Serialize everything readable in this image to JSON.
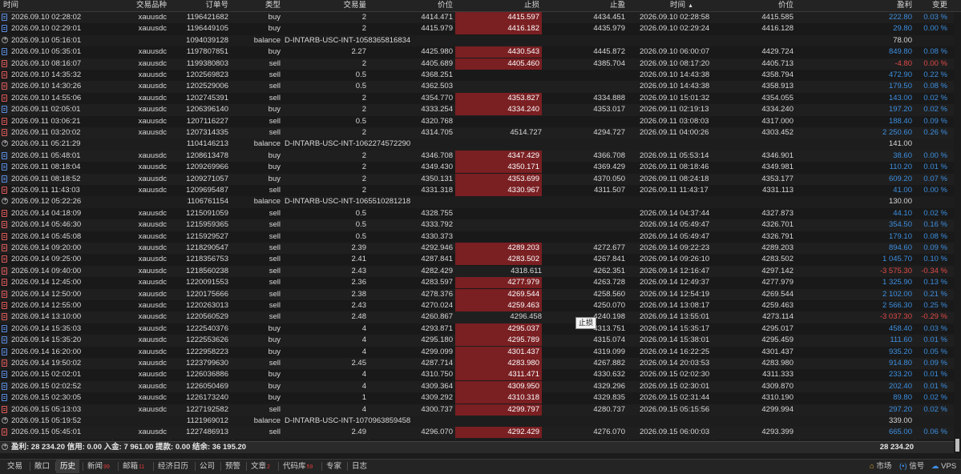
{
  "headers": {
    "time": "时间",
    "symbol": "交易品种",
    "order": "订单号",
    "type": "类型",
    "volume": "交易量",
    "price": "价位",
    "sl": "止损",
    "tp": "止盈",
    "close_time": "时间",
    "close_price": "价位",
    "profit": "盈利",
    "change": "变更",
    "sort_arrow": "▲"
  },
  "rows": [
    {
      "kind": "trade",
      "time": "2026.09.10 02:28:02",
      "symbol": "xauusdc",
      "order": "1196421682",
      "type": "buy",
      "volume": "2",
      "price": "4414.471",
      "sl": "4415.597",
      "tp": "4434.451",
      "close_time": "2026.09.10 02:28:58",
      "close_price": "4415.585",
      "profit": "222.80",
      "change": "0.03 %",
      "sl_hl": true,
      "sign": "pos"
    },
    {
      "kind": "trade",
      "time": "2026.09.10 02:29:01",
      "symbol": "xauusdc",
      "order": "1196449105",
      "type": "buy",
      "volume": "2",
      "price": "4415.979",
      "sl": "4416.182",
      "tp": "4435.979",
      "close_time": "2026.09.10 02:29:24",
      "close_price": "4416.128",
      "profit": "29.80",
      "change": "0.00 %",
      "sl_hl": true,
      "sign": "pos"
    },
    {
      "kind": "balance",
      "time": "2026.09.10 05:16:01",
      "order": "1094039128",
      "type": "balance",
      "comment": "D-INTARB-USC-INT-1058365816834",
      "profit": "78.00"
    },
    {
      "kind": "trade",
      "time": "2026.09.10 05:35:01",
      "symbol": "xauusdc",
      "order": "1197807851",
      "type": "buy",
      "volume": "2.27",
      "price": "4425.980",
      "sl": "4430.543",
      "tp": "4445.872",
      "close_time": "2026.09.10 06:00:07",
      "close_price": "4429.724",
      "profit": "849.80",
      "change": "0.08 %",
      "sl_hl": true,
      "sign": "pos"
    },
    {
      "kind": "trade",
      "time": "2026.09.10 08:16:07",
      "symbol": "xauusdc",
      "order": "1199380803",
      "type": "sell",
      "volume": "2",
      "price": "4405.689",
      "sl": "4405.460",
      "tp": "4385.704",
      "close_time": "2026.09.10 08:17:20",
      "close_price": "4405.713",
      "profit": "-4.80",
      "change": "0.00 %",
      "sl_hl": true,
      "sign": "neg"
    },
    {
      "kind": "trade",
      "time": "2026.09.10 14:35:32",
      "symbol": "xauusdc",
      "order": "1202569823",
      "type": "sell",
      "volume": "0.5",
      "price": "4368.251",
      "sl": "",
      "tp": "",
      "close_time": "2026.09.10 14:43:38",
      "close_price": "4358.794",
      "profit": "472.90",
      "change": "0.22 %",
      "sl_hl": false,
      "sign": "pos"
    },
    {
      "kind": "trade",
      "time": "2026.09.10 14:30:26",
      "symbol": "xauusdc",
      "order": "1202529006",
      "type": "sell",
      "volume": "0.5",
      "price": "4362.503",
      "sl": "",
      "tp": "",
      "close_time": "2026.09.10 14:43:38",
      "close_price": "4358.913",
      "profit": "179.50",
      "change": "0.08 %",
      "sl_hl": false,
      "sign": "pos"
    },
    {
      "kind": "trade",
      "time": "2026.09.10 14:55:06",
      "symbol": "xauusdc",
      "order": "1202745391",
      "type": "sell",
      "volume": "2",
      "price": "4354.770",
      "sl": "4353.827",
      "tp": "4334.888",
      "close_time": "2026.09.10 15:01:32",
      "close_price": "4354.055",
      "profit": "143.00",
      "change": "0.02 %",
      "sl_hl": true,
      "sign": "pos"
    },
    {
      "kind": "trade",
      "time": "2026.09.11 02:05:01",
      "symbol": "xauusdc",
      "order": "1206396140",
      "type": "buy",
      "volume": "2",
      "price": "4333.254",
      "sl": "4334.240",
      "tp": "4353.017",
      "close_time": "2026.09.11 02:19:13",
      "close_price": "4334.240",
      "profit": "197.20",
      "change": "0.02 %",
      "sl_hl": true,
      "sign": "pos"
    },
    {
      "kind": "trade",
      "time": "2026.09.11 03:06:21",
      "symbol": "xauusdc",
      "order": "1207116227",
      "type": "sell",
      "volume": "0.5",
      "price": "4320.768",
      "sl": "",
      "tp": "",
      "close_time": "2026.09.11 03:08:03",
      "close_price": "4317.000",
      "profit": "188.40",
      "change": "0.09 %",
      "sl_hl": false,
      "sign": "pos"
    },
    {
      "kind": "trade",
      "time": "2026.09.11 03:20:02",
      "symbol": "xauusdc",
      "order": "1207314335",
      "type": "sell",
      "volume": "2",
      "price": "4314.705",
      "sl": "4514.727",
      "tp": "4294.727",
      "close_time": "2026.09.11 04:00:26",
      "close_price": "4303.452",
      "profit": "2 250.60",
      "change": "0.26 %",
      "sl_hl": false,
      "sign": "pos"
    },
    {
      "kind": "balance",
      "time": "2026.09.11 05:21:29",
      "order": "1104146213",
      "type": "balance",
      "comment": "D-INTARB-USC-INT-1062274572290",
      "profit": "141.00"
    },
    {
      "kind": "trade",
      "time": "2026.09.11 05:48:01",
      "symbol": "xauusdc",
      "order": "1208613478",
      "type": "buy",
      "volume": "2",
      "price": "4346.708",
      "sl": "4347.429",
      "tp": "4366.708",
      "close_time": "2026.09.11 05:53:14",
      "close_price": "4346.901",
      "profit": "38.60",
      "change": "0.00 %",
      "sl_hl": true,
      "sign": "pos"
    },
    {
      "kind": "trade",
      "time": "2026.09.11 08:18:04",
      "symbol": "xauusdc",
      "order": "1209269966",
      "type": "buy",
      "volume": "2",
      "price": "4349.430",
      "sl": "4350.171",
      "tp": "4369.429",
      "close_time": "2026.09.11 08:18:46",
      "close_price": "4349.981",
      "profit": "110.20",
      "change": "0.01 %",
      "sl_hl": true,
      "sign": "pos"
    },
    {
      "kind": "trade",
      "time": "2026.09.11 08:18:52",
      "symbol": "xauusdc",
      "order": "1209271057",
      "type": "buy",
      "volume": "2",
      "price": "4350.131",
      "sl": "4353.699",
      "tp": "4370.050",
      "close_time": "2026.09.11 08:24:18",
      "close_price": "4353.177",
      "profit": "609.20",
      "change": "0.07 %",
      "sl_hl": true,
      "sign": "pos"
    },
    {
      "kind": "trade",
      "time": "2026.09.11 11:43:03",
      "symbol": "xauusdc",
      "order": "1209695487",
      "type": "sell",
      "volume": "2",
      "price": "4331.318",
      "sl": "4330.967",
      "tp": "4311.507",
      "close_time": "2026.09.11 11:43:17",
      "close_price": "4331.113",
      "profit": "41.00",
      "change": "0.00 %",
      "sl_hl": true,
      "sign": "pos"
    },
    {
      "kind": "balance",
      "time": "2026.09.12 05:22:26",
      "order": "1106761154",
      "type": "balance",
      "comment": "D-INTARB-USC-INT-1065510281218",
      "profit": "130.00"
    },
    {
      "kind": "trade",
      "time": "2026.09.14 04:18:09",
      "symbol": "xauusdc",
      "order": "1215091059",
      "type": "sell",
      "volume": "0.5",
      "price": "4328.755",
      "sl": "",
      "tp": "",
      "close_time": "2026.09.14 04:37:44",
      "close_price": "4327.873",
      "profit": "44.10",
      "change": "0.02 %",
      "sl_hl": false,
      "sign": "pos"
    },
    {
      "kind": "trade",
      "time": "2026.09.14 05:46:30",
      "symbol": "xauusdc",
      "order": "1215959365",
      "type": "sell",
      "volume": "0.5",
      "price": "4333.792",
      "sl": "",
      "tp": "",
      "close_time": "2026.09.14 05:49:47",
      "close_price": "4326.701",
      "profit": "354.50",
      "change": "0.16 %",
      "sl_hl": false,
      "sign": "pos"
    },
    {
      "kind": "trade",
      "time": "2026.09.14 05:45:08",
      "symbol": "xauusdc",
      "order": "1215929527",
      "type": "sell",
      "volume": "0.5",
      "price": "4330.373",
      "sl": "",
      "tp": "",
      "close_time": "2026.09.14 05:49:47",
      "close_price": "4326.791",
      "profit": "179.10",
      "change": "0.08 %",
      "sl_hl": false,
      "sign": "pos"
    },
    {
      "kind": "trade",
      "time": "2026.09.14 09:20:00",
      "symbol": "xauusdc",
      "order": "1218290547",
      "type": "sell",
      "volume": "2.39",
      "price": "4292.946",
      "sl": "4289.203",
      "tp": "4272.677",
      "close_time": "2026.09.14 09:22:23",
      "close_price": "4289.203",
      "profit": "894.60",
      "change": "0.09 %",
      "sl_hl": true,
      "sign": "pos"
    },
    {
      "kind": "trade",
      "time": "2026.09.14 09:25:00",
      "symbol": "xauusdc",
      "order": "1218356753",
      "type": "sell",
      "volume": "2.41",
      "price": "4287.841",
      "sl": "4283.502",
      "tp": "4267.841",
      "close_time": "2026.09.14 09:26:10",
      "close_price": "4283.502",
      "profit": "1 045.70",
      "change": "0.10 %",
      "sl_hl": true,
      "sign": "pos"
    },
    {
      "kind": "trade",
      "time": "2026.09.14 09:40:00",
      "symbol": "xauusdc",
      "order": "1218560238",
      "type": "sell",
      "volume": "2.43",
      "price": "4282.429",
      "sl": "4318.611",
      "tp": "4262.351",
      "close_time": "2026.09.14 12:16:47",
      "close_price": "4297.142",
      "profit": "-3 575.30",
      "change": "-0.34 %",
      "sl_hl": false,
      "sign": "neg"
    },
    {
      "kind": "trade",
      "time": "2026.09.14 12:45:00",
      "symbol": "xauusdc",
      "order": "1220091553",
      "type": "sell",
      "volume": "2.36",
      "price": "4283.597",
      "sl": "4277.979",
      "tp": "4263.728",
      "close_time": "2026.09.14 12:49:37",
      "close_price": "4277.979",
      "profit": "1 325.90",
      "change": "0.13 %",
      "sl_hl": true,
      "sign": "pos"
    },
    {
      "kind": "trade",
      "time": "2026.09.14 12:50:00",
      "symbol": "xauusdc",
      "order": "1220175666",
      "type": "sell",
      "volume": "2.38",
      "price": "4278.376",
      "sl": "4269.544",
      "tp": "4258.560",
      "close_time": "2026.09.14 12:54:19",
      "close_price": "4269.544",
      "profit": "2 102.00",
      "change": "0.21 %",
      "sl_hl": true,
      "sign": "pos"
    },
    {
      "kind": "trade",
      "time": "2026.09.14 12:55:00",
      "symbol": "xauusdc",
      "order": "1220263013",
      "type": "sell",
      "volume": "2.43",
      "price": "4270.024",
      "sl": "4259.463",
      "tp": "4250.070",
      "close_time": "2026.09.14 13:08:17",
      "close_price": "4259.463",
      "profit": "2 566.30",
      "change": "0.25 %",
      "sl_hl": true,
      "sign": "pos"
    },
    {
      "kind": "trade",
      "time": "2026.09.14 13:10:00",
      "symbol": "xauusdc",
      "order": "1220560529",
      "type": "sell",
      "volume": "2.48",
      "price": "4260.867",
      "sl": "4296.458",
      "tp": "4240.198",
      "close_time": "2026.09.14 13:55:01",
      "close_price": "4273.114",
      "profit": "-3 037.30",
      "change": "-0.29 %",
      "sl_hl": false,
      "sign": "neg"
    },
    {
      "kind": "trade",
      "time": "2026.09.14 15:35:03",
      "symbol": "xauusdc",
      "order": "1222540376",
      "type": "buy",
      "volume": "4",
      "price": "4293.871",
      "sl": "4295.037",
      "tp": "4313.751",
      "close_time": "2026.09.14 15:35:17",
      "close_price": "4295.017",
      "profit": "458.40",
      "change": "0.03 %",
      "sl_hl": true,
      "sign": "pos"
    },
    {
      "kind": "trade",
      "time": "2026.09.14 15:35:20",
      "symbol": "xauusdc",
      "order": "1222553626",
      "type": "buy",
      "volume": "4",
      "price": "4295.180",
      "sl": "4295.789",
      "tp": "4315.074",
      "close_time": "2026.09.14 15:38:01",
      "close_price": "4295.459",
      "profit": "111.60",
      "change": "0.01 %",
      "sl_hl": true,
      "sign": "pos"
    },
    {
      "kind": "trade",
      "time": "2026.09.14 16:20:00",
      "symbol": "xauusdc",
      "order": "1222958223",
      "type": "buy",
      "volume": "4",
      "price": "4299.099",
      "sl": "4301.437",
      "tp": "4319.099",
      "close_time": "2026.09.14 16:22:25",
      "close_price": "4301.437",
      "profit": "935.20",
      "change": "0.05 %",
      "sl_hl": true,
      "sign": "pos"
    },
    {
      "kind": "trade",
      "time": "2026.09.14 19:50:02",
      "symbol": "xauusdc",
      "order": "1223799630",
      "type": "sell",
      "volume": "2.45",
      "price": "4287.714",
      "sl": "4283.980",
      "tp": "4267.882",
      "close_time": "2026.09.14 20:03:53",
      "close_price": "4283.980",
      "profit": "914.80",
      "change": "0.09 %",
      "sl_hl": true,
      "sign": "pos"
    },
    {
      "kind": "trade",
      "time": "2026.09.15 02:02:01",
      "symbol": "xauusdc",
      "order": "1226036886",
      "type": "buy",
      "volume": "4",
      "price": "4310.750",
      "sl": "4311.471",
      "tp": "4330.632",
      "close_time": "2026.09.15 02:02:30",
      "close_price": "4311.333",
      "profit": "233.20",
      "change": "0.01 %",
      "sl_hl": true,
      "sign": "pos"
    },
    {
      "kind": "trade",
      "time": "2026.09.15 02:02:52",
      "symbol": "xauusdc",
      "order": "1226050469",
      "type": "buy",
      "volume": "4",
      "price": "4309.364",
      "sl": "4309.950",
      "tp": "4329.296",
      "close_time": "2026.09.15 02:30:01",
      "close_price": "4309.870",
      "profit": "202.40",
      "change": "0.01 %",
      "sl_hl": true,
      "sign": "pos"
    },
    {
      "kind": "trade",
      "time": "2026.09.15 02:30:05",
      "symbol": "xauusdc",
      "order": "1226173240",
      "type": "buy",
      "volume": "1",
      "price": "4309.292",
      "sl": "4310.318",
      "tp": "4329.835",
      "close_time": "2026.09.15 02:31:44",
      "close_price": "4310.190",
      "profit": "89.80",
      "change": "0.02 %",
      "sl_hl": true,
      "sign": "pos"
    },
    {
      "kind": "trade",
      "time": "2026.09.15 05:13:03",
      "symbol": "xauusdc",
      "order": "1227192582",
      "type": "sell",
      "volume": "4",
      "price": "4300.737",
      "sl": "4299.797",
      "tp": "4280.737",
      "close_time": "2026.09.15 05:15:56",
      "close_price": "4299.994",
      "profit": "297.20",
      "change": "0.02 %",
      "sl_hl": true,
      "sign": "pos"
    },
    {
      "kind": "balance",
      "time": "2026.09.15 05:19:52",
      "order": "1121969012",
      "type": "balance",
      "comment": "D-INTARB-USC-INT-1070963859458",
      "profit": "339.00"
    },
    {
      "kind": "trade",
      "time": "2026.09.15 05:45:01",
      "symbol": "xauusdc",
      "order": "1227486913",
      "type": "sell",
      "volume": "2.49",
      "price": "4296.070",
      "sl": "4292.429",
      "tp": "4276.070",
      "close_time": "2026.09.15 06:00:03",
      "close_price": "4293.399",
      "profit": "665.00",
      "change": "0.06 %",
      "sl_hl": true,
      "sign": "pos"
    }
  ],
  "summary": {
    "text": "盈利: 28 234.20  信用: 0.00  入金: 7 961.00  提款: 0.00  结余: 36 195.20",
    "total": "28 234.20"
  },
  "tooltip": "止损",
  "tabs": [
    {
      "label": "交易",
      "badge": ""
    },
    {
      "label": "敞口",
      "badge": ""
    },
    {
      "label": "历史",
      "badge": "",
      "active": true
    },
    {
      "label": "新闻",
      "badge": "99"
    },
    {
      "label": "邮箱",
      "badge": "11"
    },
    {
      "label": "经济日历",
      "badge": ""
    },
    {
      "label": "公司",
      "badge": ""
    },
    {
      "label": "预警",
      "badge": ""
    },
    {
      "label": "文章",
      "badge": "2"
    },
    {
      "label": "代码库",
      "badge": "59"
    },
    {
      "label": "专家",
      "badge": ""
    },
    {
      "label": "日志",
      "badge": ""
    }
  ],
  "status": {
    "market": "市场",
    "signals": "信号",
    "vps": "VPS"
  },
  "colors": {
    "positive": "#3d8fe0",
    "negative": "#e24a4a",
    "sl_highlight": "#7a1f22"
  }
}
